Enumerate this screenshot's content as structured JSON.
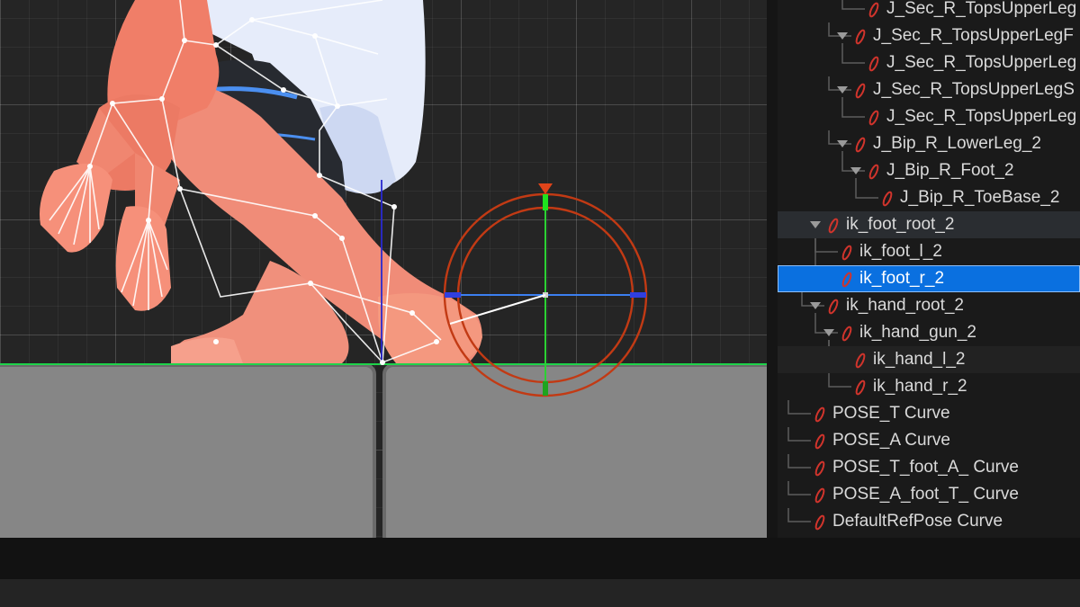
{
  "viewport": {
    "label": ""
  },
  "tree": {
    "items": [
      {
        "label": "J_Sec_R_TopsUpperLeg",
        "depth": 5,
        "expander": false,
        "state": "normal"
      },
      {
        "label": "J_Sec_R_TopsUpperLegF",
        "depth": 4,
        "expander": true,
        "state": "normal"
      },
      {
        "label": "J_Sec_R_TopsUpperLeg",
        "depth": 5,
        "expander": false,
        "state": "normal"
      },
      {
        "label": "J_Sec_R_TopsUpperLegS",
        "depth": 4,
        "expander": true,
        "state": "normal"
      },
      {
        "label": "J_Sec_R_TopsUpperLeg",
        "depth": 5,
        "expander": false,
        "state": "normal"
      },
      {
        "label": "J_Bip_R_LowerLeg_2",
        "depth": 4,
        "expander": true,
        "state": "normal"
      },
      {
        "label": "J_Bip_R_Foot_2",
        "depth": 5,
        "expander": true,
        "state": "normal"
      },
      {
        "label": "J_Bip_R_ToeBase_2",
        "depth": 6,
        "expander": false,
        "state": "normal"
      },
      {
        "label": "ik_foot_root_2",
        "depth": 2,
        "expander": true,
        "state": "parent"
      },
      {
        "label": "ik_foot_l_2",
        "depth": 3,
        "expander": false,
        "state": "normal"
      },
      {
        "label": "ik_foot_r_2",
        "depth": 3,
        "expander": false,
        "state": "selected"
      },
      {
        "label": "ik_hand_root_2",
        "depth": 2,
        "expander": true,
        "state": "normal"
      },
      {
        "label": "ik_hand_gun_2",
        "depth": 3,
        "expander": true,
        "state": "normal"
      },
      {
        "label": "ik_hand_l_2",
        "depth": 4,
        "expander": false,
        "state": "hover"
      },
      {
        "label": "ik_hand_r_2",
        "depth": 4,
        "expander": false,
        "state": "normal"
      },
      {
        "label": "POSE_T Curve",
        "depth": 1,
        "expander": false,
        "state": "normal"
      },
      {
        "label": "POSE_A Curve",
        "depth": 1,
        "expander": false,
        "state": "normal"
      },
      {
        "label": "POSE_T_foot_A_ Curve",
        "depth": 1,
        "expander": false,
        "state": "normal"
      },
      {
        "label": "POSE_A_foot_T_ Curve",
        "depth": 1,
        "expander": false,
        "state": "normal"
      },
      {
        "label": "DefaultRefPose Curve",
        "depth": 1,
        "expander": false,
        "state": "normal"
      }
    ]
  },
  "icons": {
    "bone": "bone-icon",
    "expander": "triangle-down-icon"
  },
  "colors": {
    "selection": "#0a70e0",
    "bone_icon": "#d0342c",
    "gizmo_ring": "#c23a14",
    "axis_x": "#3b7ff0",
    "axis_y": "#2bd133",
    "ground_line": "#1fd34a"
  }
}
